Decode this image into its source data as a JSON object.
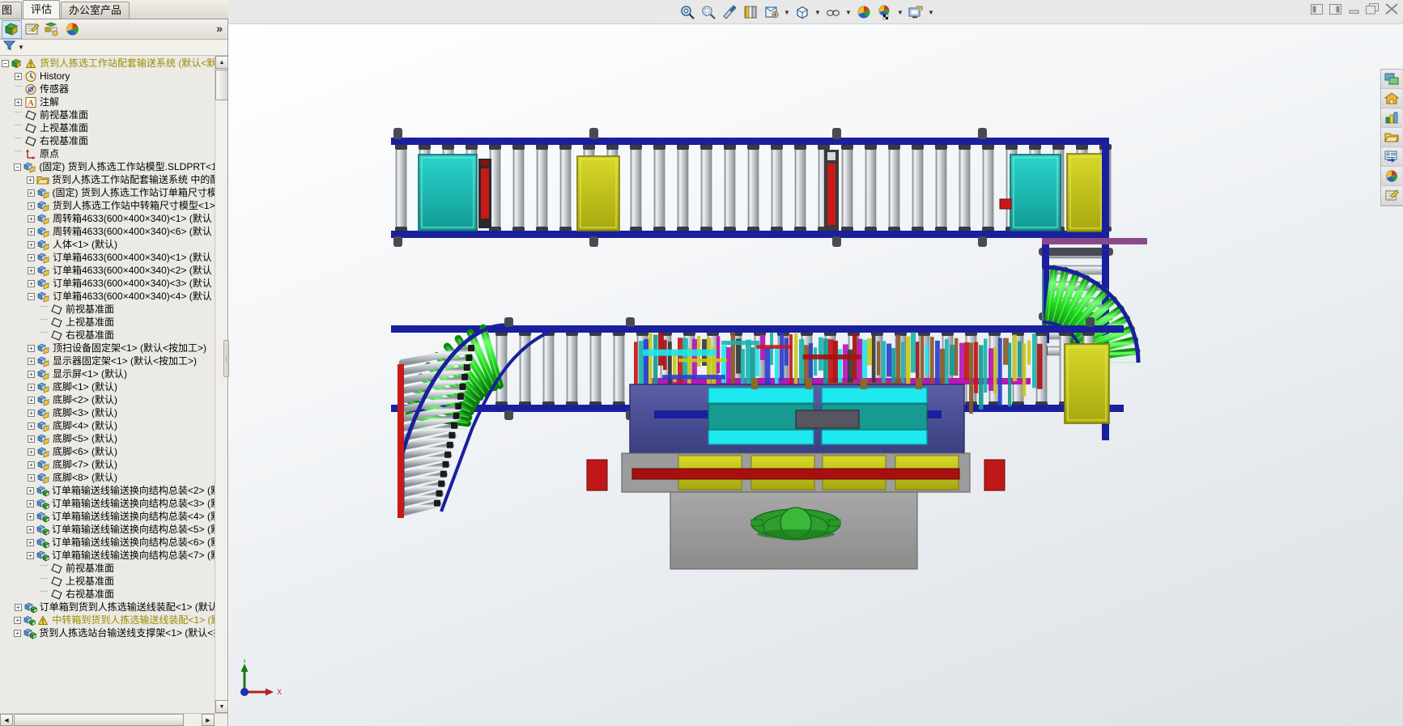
{
  "window": {
    "buttons": [
      {
        "name": "restore-left-pane-button",
        "glyph": "[◧"
      },
      {
        "name": "restore-right-pane-button",
        "glyph": "◨]"
      },
      {
        "name": "minimize-button",
        "glyph": "—"
      },
      {
        "name": "restore-button",
        "glyph": "❐"
      },
      {
        "name": "close-button",
        "glyph": "✕"
      }
    ]
  },
  "tabs": [
    {
      "label": "图",
      "active": false,
      "clipped": true
    },
    {
      "label": "评估",
      "active": true,
      "clipped": false
    },
    {
      "label": "办公室产品",
      "active": false,
      "clipped": false
    }
  ],
  "view_toolbar": {
    "items": [
      {
        "name": "zoom-to-fit-icon",
        "caret": false
      },
      {
        "name": "zoom-to-area-icon",
        "caret": false
      },
      {
        "name": "section-view-icon",
        "caret": false
      },
      {
        "name": "view-orientation-icon",
        "caret": false
      },
      {
        "name": "display-style-icon",
        "caret": true
      },
      {
        "name": "hide-show-items-icon",
        "caret": true
      },
      {
        "name": "apply-scene-icon",
        "caret": true
      },
      {
        "name": "view-settings-icon",
        "caret": false
      },
      {
        "name": "appearances-icon",
        "caret": true
      },
      {
        "name": "viewport-icon",
        "caret": true
      }
    ]
  },
  "feature_manager": {
    "tabs": [
      {
        "name": "feature-manager-tree-tab",
        "label": "FeatureManager",
        "selected": true
      },
      {
        "name": "property-manager-tab",
        "label": "PropertyManager",
        "selected": false
      },
      {
        "name": "configuration-manager-tab",
        "label": "ConfigurationManager",
        "selected": false
      },
      {
        "name": "display-manager-tab",
        "label": "DisplayManager",
        "selected": false
      }
    ],
    "overflow_label": "»",
    "filter_label": "Filter"
  },
  "tree": {
    "items": [
      {
        "depth": 0,
        "expander": "minus",
        "icon": "assembly-warn-icon",
        "label": "货到人拣选工作站配套输送系统  (默认<默",
        "warn": true
      },
      {
        "depth": 1,
        "expander": "plus",
        "icon": "history-icon",
        "label": "History",
        "warn": false
      },
      {
        "depth": 1,
        "expander": "none",
        "icon": "sensor-icon",
        "label": "传感器",
        "warn": false
      },
      {
        "depth": 1,
        "expander": "plus",
        "icon": "annotations-icon",
        "label": "注解",
        "warn": false
      },
      {
        "depth": 1,
        "expander": "none",
        "icon": "plane-icon",
        "label": "前视基准面",
        "warn": false
      },
      {
        "depth": 1,
        "expander": "none",
        "icon": "plane-icon",
        "label": "上视基准面",
        "warn": false
      },
      {
        "depth": 1,
        "expander": "none",
        "icon": "plane-icon",
        "label": "右视基准面",
        "warn": false
      },
      {
        "depth": 1,
        "expander": "none",
        "icon": "origin-icon",
        "label": "原点",
        "warn": false
      },
      {
        "depth": 1,
        "expander": "minus",
        "icon": "part-icon",
        "label": "(固定) 货到人拣选工作站模型.SLDPRT<1>",
        "warn": false
      },
      {
        "depth": 2,
        "expander": "plus",
        "icon": "folder-icon",
        "label": "货到人拣选工作站配套输送系统 中的配",
        "warn": false
      },
      {
        "depth": 2,
        "expander": "plus",
        "icon": "part-icon",
        "label": "(固定) 货到人拣选工作站订单箱尺寸模",
        "warn": false
      },
      {
        "depth": 2,
        "expander": "plus",
        "icon": "part-icon",
        "label": "货到人拣选工作站中转箱尺寸模型<1>",
        "warn": false
      },
      {
        "depth": 2,
        "expander": "plus",
        "icon": "part-icon",
        "label": "周转箱4633(600×400×340)<1> (默认",
        "warn": false
      },
      {
        "depth": 2,
        "expander": "plus",
        "icon": "part-icon",
        "label": "周转箱4633(600×400×340)<6> (默认",
        "warn": false
      },
      {
        "depth": 2,
        "expander": "plus",
        "icon": "part-icon",
        "label": "人体<1> (默认)",
        "warn": false
      },
      {
        "depth": 2,
        "expander": "plus",
        "icon": "part-icon",
        "label": "订单箱4633(600×400×340)<1> (默认",
        "warn": false
      },
      {
        "depth": 2,
        "expander": "plus",
        "icon": "part-icon",
        "label": "订单箱4633(600×400×340)<2> (默认",
        "warn": false
      },
      {
        "depth": 2,
        "expander": "plus",
        "icon": "part-icon",
        "label": "订单箱4633(600×400×340)<3> (默认",
        "warn": false
      },
      {
        "depth": 2,
        "expander": "minus",
        "icon": "part-icon",
        "label": "订单箱4633(600×400×340)<4> (默认",
        "warn": false
      },
      {
        "depth": 3,
        "expander": "none",
        "icon": "plane-icon",
        "label": "前视基准面",
        "warn": false
      },
      {
        "depth": 3,
        "expander": "none",
        "icon": "plane-icon",
        "label": "上视基准面",
        "warn": false
      },
      {
        "depth": 3,
        "expander": "none",
        "icon": "plane-icon",
        "label": "右视基准面",
        "warn": false
      },
      {
        "depth": 2,
        "expander": "plus",
        "icon": "part-icon",
        "label": "顶扫设备固定架<1> (默认<按加工>)",
        "warn": false
      },
      {
        "depth": 2,
        "expander": "plus",
        "icon": "part-icon",
        "label": "显示器固定架<1> (默认<按加工>)",
        "warn": false
      },
      {
        "depth": 2,
        "expander": "plus",
        "icon": "part-icon",
        "label": "显示屏<1> (默认)",
        "warn": false
      },
      {
        "depth": 2,
        "expander": "plus",
        "icon": "part-icon",
        "label": "底脚<1> (默认)",
        "warn": false
      },
      {
        "depth": 2,
        "expander": "plus",
        "icon": "part-icon",
        "label": "底脚<2> (默认)",
        "warn": false
      },
      {
        "depth": 2,
        "expander": "plus",
        "icon": "part-icon",
        "label": "底脚<3> (默认)",
        "warn": false
      },
      {
        "depth": 2,
        "expander": "plus",
        "icon": "part-icon",
        "label": "底脚<4> (默认)",
        "warn": false
      },
      {
        "depth": 2,
        "expander": "plus",
        "icon": "part-icon",
        "label": "底脚<5> (默认)",
        "warn": false
      },
      {
        "depth": 2,
        "expander": "plus",
        "icon": "part-icon",
        "label": "底脚<6> (默认)",
        "warn": false
      },
      {
        "depth": 2,
        "expander": "plus",
        "icon": "part-icon",
        "label": "底脚<7> (默认)",
        "warn": false
      },
      {
        "depth": 2,
        "expander": "plus",
        "icon": "part-icon",
        "label": "底脚<8> (默认)",
        "warn": false
      },
      {
        "depth": 2,
        "expander": "plus",
        "icon": "subassembly-icon",
        "label": "订单箱输送线输送换向结构总装<2> (默",
        "warn": false
      },
      {
        "depth": 2,
        "expander": "plus",
        "icon": "subassembly-icon",
        "label": "订单箱输送线输送换向结构总装<3> (默",
        "warn": false
      },
      {
        "depth": 2,
        "expander": "plus",
        "icon": "subassembly-icon",
        "label": "订单箱输送线输送换向结构总装<4> (默",
        "warn": false
      },
      {
        "depth": 2,
        "expander": "plus",
        "icon": "subassembly-icon",
        "label": "订单箱输送线输送换向结构总装<5> (默",
        "warn": false
      },
      {
        "depth": 2,
        "expander": "plus",
        "icon": "subassembly-icon",
        "label": "订单箱输送线输送换向结构总装<6> (默",
        "warn": false
      },
      {
        "depth": 2,
        "expander": "plus",
        "icon": "subassembly-icon",
        "label": "订单箱输送线输送换向结构总装<7> (默",
        "warn": false
      },
      {
        "depth": 3,
        "expander": "none",
        "icon": "plane-icon",
        "label": "前视基准面",
        "warn": false
      },
      {
        "depth": 3,
        "expander": "none",
        "icon": "plane-icon",
        "label": "上视基准面",
        "warn": false
      },
      {
        "depth": 3,
        "expander": "none",
        "icon": "plane-icon",
        "label": "右视基准面",
        "warn": false
      },
      {
        "depth": 1,
        "expander": "plus",
        "icon": "subassembly-icon",
        "label": "订单箱到货到人拣选输送线装配<1> (默认",
        "warn": false
      },
      {
        "depth": 1,
        "expander": "plus",
        "icon": "subassembly-warn-icon",
        "label": "中转箱到货到人拣选输送线装配<1> (默",
        "warn": true
      },
      {
        "depth": 1,
        "expander": "plus",
        "icon": "subassembly-icon",
        "label": "货到人拣选站台输送线支撑架<1> (默认<打",
        "warn": false
      }
    ]
  },
  "right_toolbar": {
    "items": [
      {
        "name": "view-palette-icon"
      },
      {
        "name": "appearances-home-icon"
      },
      {
        "name": "scenes-lights-icon"
      },
      {
        "name": "file-explorer-icon"
      },
      {
        "name": "design-library-icon"
      },
      {
        "name": "appearances-sphere-icon"
      },
      {
        "name": "custom-properties-icon"
      }
    ]
  },
  "axis_indicator": {
    "x_label": "X",
    "y_label": "Y",
    "x_color": "#b22222",
    "y_color": "#1a7a1a",
    "origin_color": "#1b2fa8"
  },
  "model_colors": {
    "frame_blue": "#1a1f9e",
    "roller_gray": "#b8bcc0",
    "roller_green": "#18d418",
    "box_teal": "#19b5ae",
    "box_yellow": "#c8c818",
    "base_gray": "#9a9a9a",
    "station_navy": "#4a4f96",
    "magenta_rail": "#b618b6",
    "red_bar": "#a81010",
    "cyan_panel": "#1ee8f0",
    "green_sphere": "#28a428"
  }
}
